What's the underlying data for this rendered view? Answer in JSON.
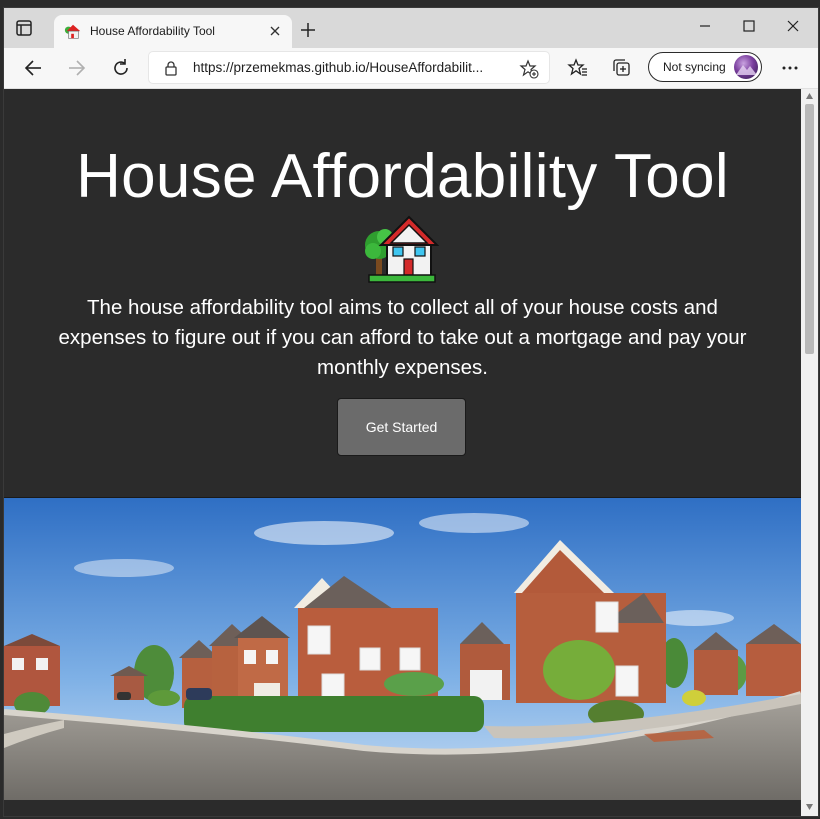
{
  "browser": {
    "tab": {
      "title": "House Affordability Tool"
    },
    "address_bar": {
      "url": "https://przemekmas.github.io/HouseAffordabilit..."
    },
    "profile": {
      "sync_label": "Not syncing"
    }
  },
  "page": {
    "title": "House Affordability Tool",
    "description": "The house affordability tool aims to collect all of your house costs and expenses to figure out if you can afford to take out a mortgage and pay your monthly expenses.",
    "cta_label": "Get Started",
    "icons": {
      "hero": "house-with-garden-icon",
      "photo": "residential-street-photo"
    }
  },
  "colors": {
    "hero_background": "#2b2b2b",
    "button_background": "#6b6b6b",
    "text": "#ffffff"
  }
}
